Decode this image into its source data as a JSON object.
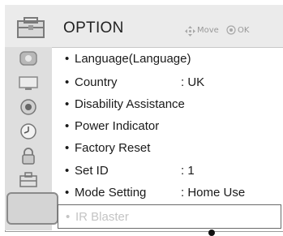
{
  "menu": {
    "title": "OPTION",
    "hint_move": "Move",
    "hint_ok": "OK",
    "icons": {
      "header": "option-toolbox-icon",
      "move": "four-way-arrow-icon",
      "ok": "ok-circle-icon"
    }
  },
  "sidebar": {
    "items": [
      {
        "icon": "picture-icon"
      },
      {
        "icon": "screen-icon"
      },
      {
        "icon": "audio-icon"
      },
      {
        "icon": "clock-icon"
      },
      {
        "icon": "lock-icon"
      },
      {
        "icon": "option-icon",
        "selected": true
      },
      {
        "icon": "network-icon"
      }
    ]
  },
  "options": [
    {
      "label": "Language(Language)",
      "value": ""
    },
    {
      "label": "Country",
      "value": ": UK"
    },
    {
      "label": "Disability Assistance",
      "value": ""
    },
    {
      "label": "Power Indicator",
      "value": ""
    },
    {
      "label": "Factory Reset",
      "value": ""
    },
    {
      "label": "Set ID",
      "value": ": 1"
    },
    {
      "label": "Mode Setting",
      "value": ": Home Use"
    },
    {
      "label": "IR Blaster",
      "value": "",
      "disabled": true
    }
  ],
  "bullet": "•"
}
